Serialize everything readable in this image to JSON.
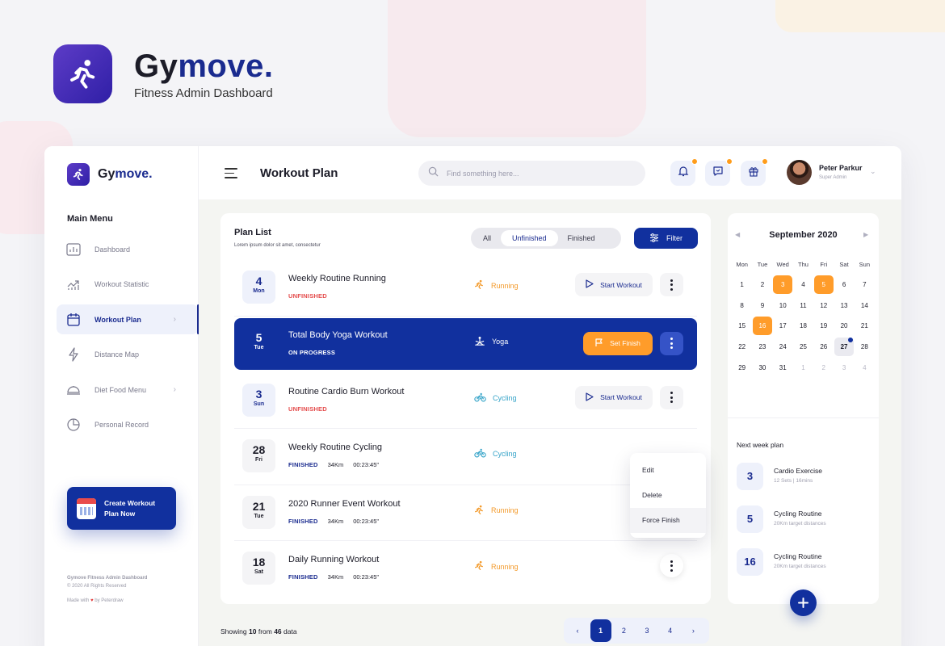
{
  "brand": {
    "name_part1": "Gy",
    "name_part2": "move.",
    "subtitle": "Fitness Admin Dashboard",
    "accent_color": "#1a2b8f",
    "logo_icon": "runner-icon"
  },
  "sidebar": {
    "logo_part1": "Gy",
    "logo_part2": "move.",
    "section_title": "Main Menu",
    "items": [
      {
        "label": "Dashboard",
        "icon": "bar-chart-icon"
      },
      {
        "label": "Workout Statistic",
        "icon": "trend-up-icon"
      },
      {
        "label": "Workout Plan",
        "icon": "calendar-icon",
        "active": true
      },
      {
        "label": "Distance Map",
        "icon": "lightning-icon"
      },
      {
        "label": "Diet Food Menu",
        "icon": "food-cover-icon"
      },
      {
        "label": "Personal Record",
        "icon": "pie-chart-icon"
      }
    ],
    "cta_label": "Create Workout Plan Now",
    "footer_title": "Gymove Fitness Admin Dashboard",
    "footer_copy": "© 2020 All Rights Reserved",
    "footer_made_prefix": "Made with",
    "footer_made_suffix": "by Peterdraw"
  },
  "header": {
    "title": "Workout Plan",
    "search_placeholder": "Find something here...",
    "user_name": "Peter Parkur",
    "user_role": "Super Admin"
  },
  "plan_list": {
    "title": "Plan List",
    "subtitle": "Lorem ipsum dolor sit amet, consectetur",
    "segments": [
      "All",
      "Unfinished",
      "Finished"
    ],
    "active_segment": "Unfinished",
    "filter_label": "Filter",
    "rows": [
      {
        "day": "4",
        "weekday": "Mon",
        "name": "Weekly Routine Running",
        "status": "UNFINISHED",
        "type": "Running",
        "action": "Start Workout"
      },
      {
        "day": "5",
        "weekday": "Tue",
        "name": "Total Body Yoga Workout",
        "status": "ON PROGRESS",
        "type": "Yoga",
        "action": "Set Finish"
      },
      {
        "day": "3",
        "weekday": "Sun",
        "name": "Routine Cardio Burn Workout",
        "status": "UNFINISHED",
        "type": "Cycling",
        "action": "Start Workout"
      },
      {
        "day": "28",
        "weekday": "Fri",
        "name": "Weekly Routine Cycling",
        "status": "FINISHED",
        "distance": "34Km",
        "duration": "00:23:45\"",
        "type": "Cycling"
      },
      {
        "day": "21",
        "weekday": "Tue",
        "name": "2020 Runner Event Workout",
        "status": "FINISHED",
        "distance": "34Km",
        "duration": "00:23:45\"",
        "type": "Running"
      },
      {
        "day": "18",
        "weekday": "Sat",
        "name": "Daily Running Workout",
        "status": "FINISHED",
        "distance": "34Km",
        "duration": "00:23:45\"",
        "type": "Running"
      }
    ],
    "context_menu": [
      "Edit",
      "Delete",
      "Force Finish"
    ]
  },
  "pagination": {
    "showing_prefix": "Showing",
    "showing_count": "10",
    "showing_mid": "from",
    "showing_total": "46",
    "showing_suffix": "data",
    "pages": [
      "1",
      "2",
      "3",
      "4"
    ],
    "prev": "‹",
    "next": "›"
  },
  "calendar": {
    "month_label": "September 2020",
    "weekdays": [
      "Mon",
      "Tue",
      "Wed",
      "Thu",
      "Fri",
      "Sat",
      "Sun"
    ],
    "weeks": [
      [
        "1",
        "2",
        "3",
        "4",
        "5",
        "6",
        "7"
      ],
      [
        "8",
        "9",
        "10",
        "11",
        "12",
        "13",
        "14"
      ],
      [
        "15",
        "16",
        "17",
        "18",
        "19",
        "20",
        "21"
      ],
      [
        "22",
        "23",
        "24",
        "25",
        "26",
        "27",
        "28"
      ],
      [
        "29",
        "30",
        "31",
        "1",
        "2",
        "3",
        "4"
      ]
    ],
    "highlighted": [
      "3",
      "5",
      "16"
    ],
    "today": "27"
  },
  "next_week": {
    "title": "Next week plan",
    "items": [
      {
        "num": "3",
        "name": "Cardio Exercise",
        "meta": "12 Sets  |  16mins"
      },
      {
        "num": "5",
        "name": "Cycling Routine",
        "meta": "20Km target distances"
      },
      {
        "num": "16",
        "name": "Cycling Routine",
        "meta": "20Km target distances"
      }
    ]
  }
}
